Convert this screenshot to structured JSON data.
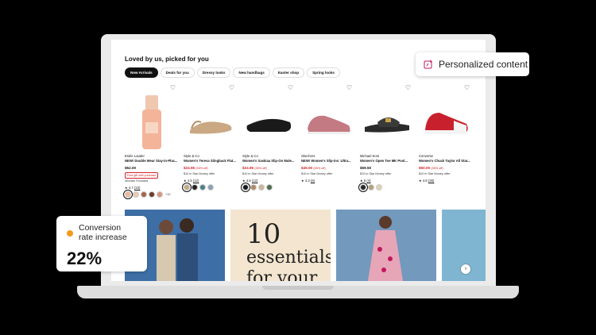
{
  "section": {
    "heading": "Loved by us, picked for you",
    "tabs": [
      "New Arrivals",
      "Deals for you",
      "Dressy looks",
      "New handbags",
      "Easter shop",
      "Spring looks"
    ]
  },
  "products": [
    {
      "brand": "Estée Lauder",
      "name": "NEW! Double Wear Stay-in-Plac...",
      "price": "$52.00",
      "promo": "Free gift with purchase",
      "founded": "Woman Founded",
      "rating": "★ 4.7",
      "reviews": "(23)",
      "more": "+10"
    },
    {
      "brand": "Style & Co",
      "name": "Women's Teresa Slingback Flat...",
      "sale": "$24.95",
      "off": "(55% off)",
      "offer": "$10 in Star Money offer",
      "rating": "★ 4.5",
      "reviews": "(12)"
    },
    {
      "brand": "Style & Co",
      "name": "Women's Saskiaa Slip-On Mule...",
      "sale": "$24.95",
      "off": "(55% off)",
      "offer": "$10 in Star Money offer",
      "rating": "★ 4.5",
      "reviews": "(12)"
    },
    {
      "brand": "Skechers",
      "name": "NEW! Women's Slip-ins: Ultra...",
      "sale": "$45.00",
      "off": "(55% off)",
      "offer": "$10 in Star Money offer",
      "rating": "★ 4.3",
      "reviews": "(6)"
    },
    {
      "brand": "Michael Kors",
      "name": "Women's Open Toe MK Pool...",
      "price": "$59.50",
      "offer": "$10 in Star Money offer",
      "rating": "★ 5",
      "reviews": "(4)"
    },
    {
      "brand": "Converse",
      "name": "Women's Chuck Taylor All Star...",
      "sale": "$50.00",
      "off": "(55% off)",
      "offer": "$10 in Star Money offer",
      "rating": "★ 4.6",
      "reviews": "(26)"
    }
  ],
  "tiles": {
    "essentials_number": "10",
    "essentials_line1": "essentials",
    "essentials_line2": "for your"
  },
  "next_icon": "chevron-right-icon",
  "personalized": {
    "label": "Personalized content",
    "icon": "sparkle-square-icon",
    "accent": "#c2185b"
  },
  "conversion": {
    "label_line1": "Conversion",
    "label_line2": "rate increase",
    "value": "22%",
    "dot_color": "#f39a1e"
  }
}
